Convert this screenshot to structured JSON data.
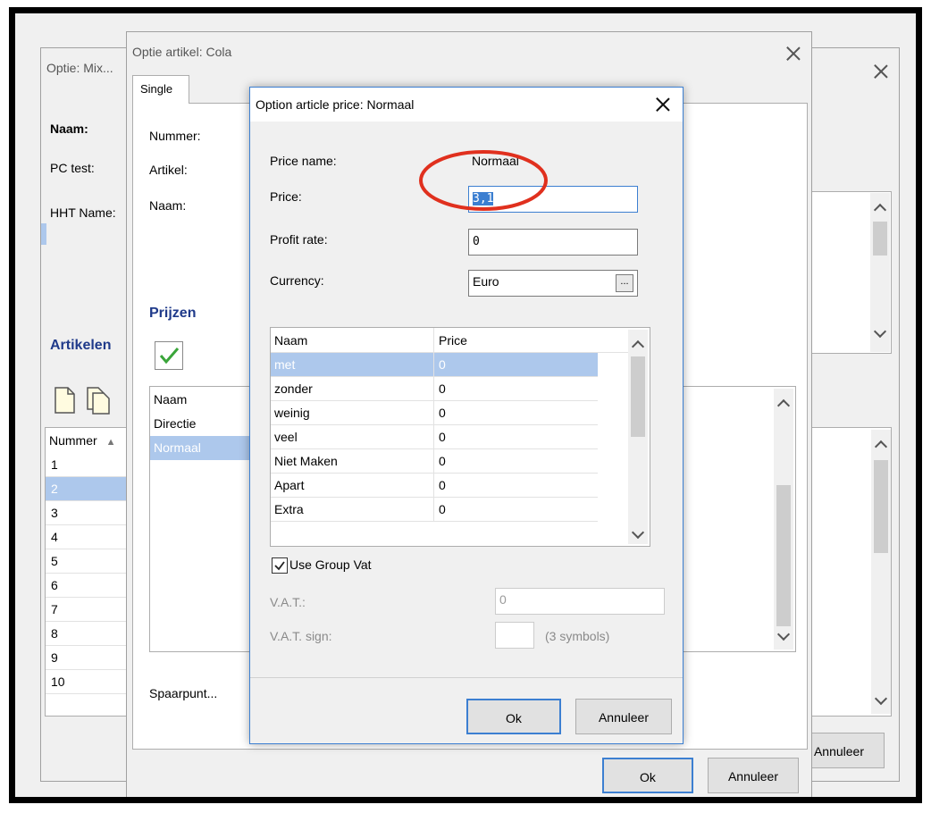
{
  "bg_window": {
    "title": "Optie: Mix...",
    "labels": {
      "naam": "Naam:",
      "pc_test": "PC test:",
      "hht_name": "HHT Name:",
      "artikelen": "Artikelen"
    },
    "grid_header": "Nummer",
    "rows": [
      "1",
      "2",
      "3",
      "4",
      "5",
      "6",
      "7",
      "8",
      "9",
      "10"
    ],
    "selected_row": 1,
    "cancel_label": "Annuleer"
  },
  "mid_window": {
    "title": "Optie artikel: Cola",
    "tab_label": "Single",
    "labels": {
      "nummer": "Nummer:",
      "artikel": "Artikel:",
      "naam": "Naam:",
      "prijzen": "Prijzen",
      "spaarpunt": "Spaarpunt..."
    },
    "price_list_header": "Naam",
    "price_list": [
      "Directie",
      "Normaal"
    ],
    "selected_price": 1,
    "ok_label": "Ok",
    "cancel_label": "Annuleer"
  },
  "dialog": {
    "title": "Option article price: Normaal",
    "labels": {
      "price_name": "Price name:",
      "price": "Price:",
      "profit_rate": "Profit rate:",
      "currency": "Currency:",
      "use_group_vat": "Use Group Vat",
      "vat": "V.A.T.:",
      "vat_sign": "V.A.T. sign:",
      "symbols_hint": "(3 symbols)"
    },
    "values": {
      "price_name": "Normaal",
      "price": "3,1",
      "profit_rate": "0",
      "currency": "Euro",
      "vat": "0",
      "vat_sign": ""
    },
    "browse_label": "...",
    "use_group_vat_checked": true,
    "grid": {
      "columns": [
        "Naam",
        "Price"
      ],
      "rows": [
        {
          "name": "met",
          "price": "0"
        },
        {
          "name": "zonder",
          "price": "0"
        },
        {
          "name": "weinig",
          "price": "0"
        },
        {
          "name": "veel",
          "price": "0"
        },
        {
          "name": "Niet Maken",
          "price": "0"
        },
        {
          "name": "Apart",
          "price": "0"
        },
        {
          "name": "Extra",
          "price": "0"
        }
      ],
      "selected_row": 0
    },
    "ok_label": "Ok",
    "cancel_label": "Annuleer"
  },
  "annotation": {
    "color": "#e0301e"
  }
}
